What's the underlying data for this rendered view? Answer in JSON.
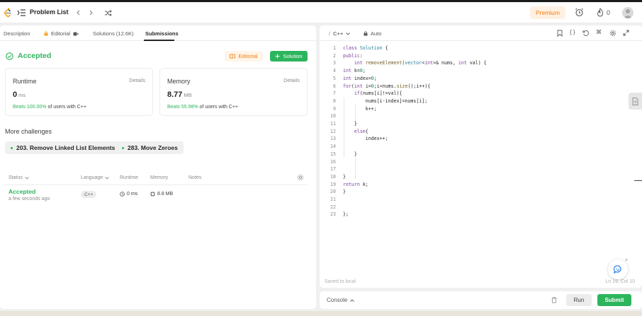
{
  "navbar": {
    "problem_list_label": "Problem List",
    "premium_label": "Premium",
    "streak_count": "0"
  },
  "tabs": [
    {
      "label": "Description"
    },
    {
      "label": "Editorial"
    },
    {
      "label": "Solutions (12.6K)"
    },
    {
      "label": "Submissions"
    }
  ],
  "result": {
    "status": "Accepted",
    "editorial_btn": "Editorial",
    "solution_btn": "Solution"
  },
  "runtime_card": {
    "title": "Runtime",
    "details": "Details",
    "value": "0",
    "unit": "ms",
    "beats_pct": "Beats 100.00%",
    "beats_rest": "of users with C++"
  },
  "memory_card": {
    "title": "Memory",
    "details": "Details",
    "value": "8.77",
    "unit": "MB",
    "beats_pct": "Beats 55.98%",
    "beats_rest": "of users with C++"
  },
  "more_challenges": {
    "title": "More challenges",
    "items": [
      {
        "label": "203. Remove Linked List Elements"
      },
      {
        "label": "283. Move Zeroes"
      }
    ]
  },
  "table": {
    "headers": {
      "status": "Status",
      "language": "Language",
      "runtime": "Runtime",
      "memory": "Memory",
      "notes": "Notes"
    },
    "rows": [
      {
        "status": "Accepted",
        "time": "a few seconds ago",
        "language": "C++",
        "runtime": "0 ms",
        "memory": "8.8 MB"
      }
    ]
  },
  "editor": {
    "language": "C++",
    "mode": "Auto",
    "saved_label": "Saved to local",
    "cursor_pos": "Ln 19, Col 10",
    "lines": [
      {
        "n": "1",
        "t": "class Solution {"
      },
      {
        "n": "2",
        "t": "public:"
      },
      {
        "n": "3",
        "t": "    int removeElement(vector<int>& nums, int val) {"
      },
      {
        "n": "4",
        "t": "int k=0;"
      },
      {
        "n": "5",
        "t": "int index=0;"
      },
      {
        "n": "6",
        "t": "for(int i=0;i<nums.size();i++){"
      },
      {
        "n": "7",
        "t": "    if(nums[i]!=val){"
      },
      {
        "n": "8",
        "t": "        nums[i-index]=nums[i];"
      },
      {
        "n": "9",
        "t": "        k++;"
      },
      {
        "n": "10",
        "t": ""
      },
      {
        "n": "11",
        "t": "    }"
      },
      {
        "n": "12",
        "t": "    else{"
      },
      {
        "n": "13",
        "t": "        index++;"
      },
      {
        "n": "14",
        "t": ""
      },
      {
        "n": "15",
        "t": "    }"
      },
      {
        "n": "16",
        "t": ""
      },
      {
        "n": "17",
        "t": ""
      },
      {
        "n": "18",
        "t": "}"
      },
      {
        "n": "19",
        "t": "return k;"
      },
      {
        "n": "20",
        "t": "}"
      },
      {
        "n": "21",
        "t": ""
      },
      {
        "n": "22",
        "t": ""
      },
      {
        "n": "23",
        "t": "};"
      }
    ]
  },
  "bottom": {
    "console_label": "Console",
    "run_label": "Run",
    "submit_label": "Submit"
  },
  "colors": {
    "accent_green": "#2db55d",
    "premium_orange": "#f57c10"
  }
}
